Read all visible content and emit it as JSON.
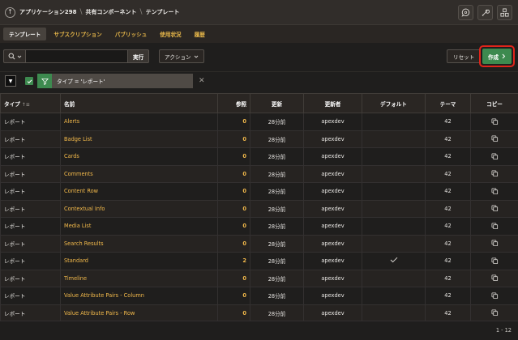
{
  "breadcrumb": [
    "アプリケーション298",
    "共有コンポーネント",
    "テンプレート"
  ],
  "tabs": [
    {
      "label": "テンプレート",
      "active": true
    },
    {
      "label": "サブスクリプション",
      "active": false
    },
    {
      "label": "パブリッシュ",
      "active": false
    },
    {
      "label": "使用状況",
      "active": false
    },
    {
      "label": "履歴",
      "active": false
    }
  ],
  "toolbar": {
    "search_value": "",
    "go_label": "実行",
    "actions_label": "アクション",
    "reset_label": "リセット",
    "create_label": "作成"
  },
  "filter": {
    "text": "タイプ = 'レポート'"
  },
  "table": {
    "headers": [
      "タイプ",
      "名前",
      "参照",
      "更新",
      "更新者",
      "デフォルト",
      "テーマ",
      "コピー"
    ],
    "rows": [
      {
        "type": "レポート",
        "name": "Alerts",
        "refs": "0",
        "updated": "28分前",
        "by": "apexdev",
        "default": false,
        "theme": "42"
      },
      {
        "type": "レポート",
        "name": "Badge List",
        "refs": "0",
        "updated": "28分前",
        "by": "apexdev",
        "default": false,
        "theme": "42"
      },
      {
        "type": "レポート",
        "name": "Cards",
        "refs": "0",
        "updated": "28分前",
        "by": "apexdev",
        "default": false,
        "theme": "42"
      },
      {
        "type": "レポート",
        "name": "Comments",
        "refs": "0",
        "updated": "28分前",
        "by": "apexdev",
        "default": false,
        "theme": "42"
      },
      {
        "type": "レポート",
        "name": "Content Row",
        "refs": "0",
        "updated": "28分前",
        "by": "apexdev",
        "default": false,
        "theme": "42"
      },
      {
        "type": "レポート",
        "name": "Contextual Info",
        "refs": "0",
        "updated": "28分前",
        "by": "apexdev",
        "default": false,
        "theme": "42"
      },
      {
        "type": "レポート",
        "name": "Media List",
        "refs": "0",
        "updated": "28分前",
        "by": "apexdev",
        "default": false,
        "theme": "42"
      },
      {
        "type": "レポート",
        "name": "Search Results",
        "refs": "0",
        "updated": "28分前",
        "by": "apexdev",
        "default": false,
        "theme": "42"
      },
      {
        "type": "レポート",
        "name": "Standard",
        "refs": "2",
        "updated": "28分前",
        "by": "apexdev",
        "default": true,
        "theme": "42"
      },
      {
        "type": "レポート",
        "name": "Timeline",
        "refs": "0",
        "updated": "28分前",
        "by": "apexdev",
        "default": false,
        "theme": "42"
      },
      {
        "type": "レポート",
        "name": "Value Attribute Pairs - Column",
        "refs": "0",
        "updated": "28分前",
        "by": "apexdev",
        "default": false,
        "theme": "42"
      },
      {
        "type": "レポート",
        "name": "Value Attribute Pairs - Row",
        "refs": "0",
        "updated": "28分前",
        "by": "apexdev",
        "default": false,
        "theme": "42"
      }
    ]
  },
  "pagination": "1 - 12",
  "icons": {
    "up": "arrow-up-circle-icon",
    "search": "search-icon",
    "copy": "copy-icon",
    "filter": "funnel-icon",
    "default_mark": "checkmark-icon"
  },
  "colors": {
    "accent_link": "#f2b94b",
    "create_button": "#3d8a4f",
    "highlight_ring": "#e0241a"
  }
}
